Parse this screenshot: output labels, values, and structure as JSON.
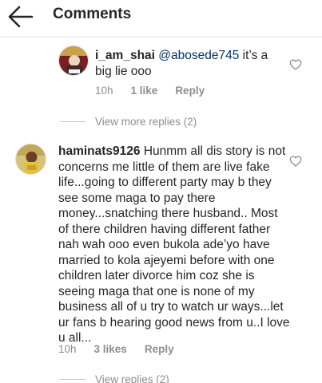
{
  "header": {
    "title": "Comments",
    "back_icon": "arrow-left-icon"
  },
  "comments": [
    {
      "username": "i_am_shai",
      "mention": "@abosede745",
      "text": " it’s a big lie ooo",
      "time": "10h",
      "likes": "1 like",
      "reply_label": "Reply",
      "view_replies": "View more replies (2)"
    },
    {
      "username": "haminats9126",
      "text": "Hunmm all dis story is not concerns me little of them are live fake life...going to different party may b they see some maga to pay there money...snatching there husband.. Most of there children having different father nah wah ooo even bukola ade’yo have married to kola ajeyemi before with one children later divorce him coz she is seeing maga that one is none of my business all of u try to watch ur ways...let ur fans b hearing good news from u..I love u all...",
      "time": "10h",
      "likes": "3 likes",
      "reply_label": "Reply",
      "view_replies": "View replies (2)"
    }
  ],
  "icons": {
    "like": "heart-outline-icon"
  },
  "colors": {
    "text": "#262626",
    "secondary": "#8e8e8e",
    "mention": "#003569"
  }
}
